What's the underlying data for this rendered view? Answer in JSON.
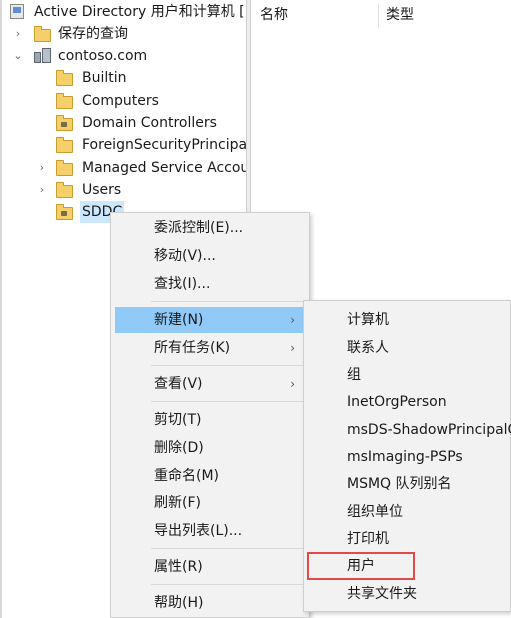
{
  "tree": {
    "root": "Active Directory 用户和计算机 [",
    "saved_queries": "保存的查询",
    "domain": "contoso.com",
    "children": [
      "Builtin",
      "Computers",
      "Domain Controllers",
      "ForeignSecurityPrincipal",
      "Managed Service Accou",
      "Users",
      "SDDC"
    ],
    "selected": "SDDC"
  },
  "list_headers": {
    "name": "名称",
    "type": "类型"
  },
  "context_menu": {
    "items": [
      "委派控制(E)...",
      "移动(V)...",
      "查找(I)...",
      "新建(N)",
      "所有任务(K)",
      "查看(V)",
      "剪切(T)",
      "删除(D)",
      "重命名(M)",
      "刷新(F)",
      "导出列表(L)...",
      "属性(R)",
      "帮助(H)"
    ],
    "highlighted": "新建(N)",
    "submenu_arrow": "›"
  },
  "new_submenu": {
    "items": [
      "计算机",
      "联系人",
      "组",
      "InetOrgPerson",
      "msDS-ShadowPrincipalC",
      "msImaging-PSPs",
      "MSMQ 队列别名",
      "组织单位",
      "打印机",
      "用户",
      "共享文件夹"
    ],
    "outlined": "用户"
  },
  "colors": {
    "highlight": "#91c9f7",
    "selection": "#cce8ff",
    "annotation": "#e04a4a",
    "folder": "#f4cf6a"
  }
}
